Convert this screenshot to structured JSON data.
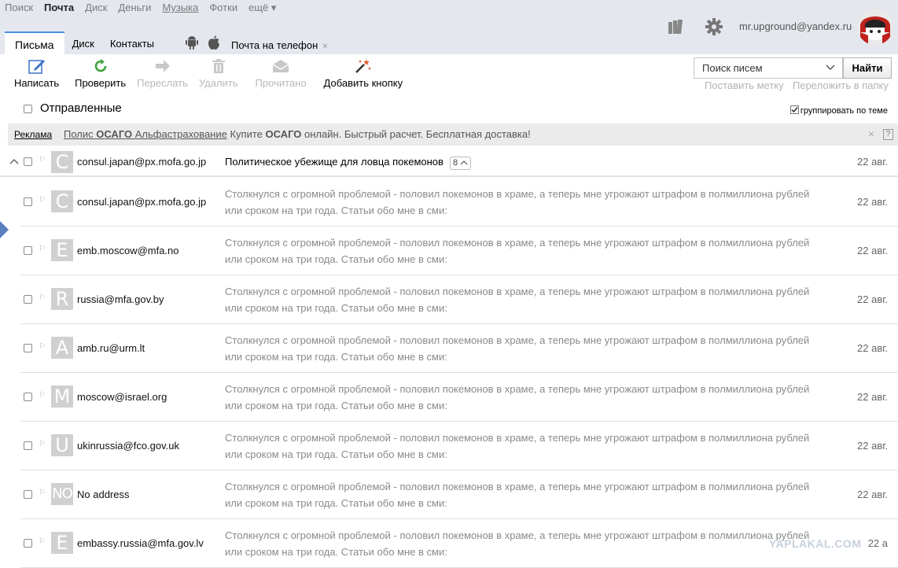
{
  "services": [
    {
      "label": "Поиск",
      "active": false
    },
    {
      "label": "Почта",
      "active": true
    },
    {
      "label": "Диск",
      "active": false
    },
    {
      "label": "Деньги",
      "active": false
    },
    {
      "label": "Музыка",
      "active": false
    },
    {
      "label": "Фотки",
      "active": false
    },
    {
      "label": "ещё ▾",
      "active": false
    }
  ],
  "tabs": [
    {
      "label": "Письма",
      "active": true
    },
    {
      "label": "Диск",
      "active": false
    },
    {
      "label": "Контакты",
      "active": false
    }
  ],
  "phone_link": "Почта на телефон",
  "user": {
    "email": "mr.upground@yandex.ru"
  },
  "toolbar": {
    "compose": "Написать",
    "check": "Проверить",
    "forward": "Переслать",
    "delete": "Удалить",
    "read": "Прочитано",
    "add_button": "Добавить кнопку"
  },
  "search": {
    "placeholder": "Поиск писем",
    "button": "Найти"
  },
  "label_links": {
    "set_label": "Поставить метку",
    "move": "Переложить в папку"
  },
  "folder": {
    "title": "Отправленные",
    "group_label": "группировать по теме"
  },
  "ad": {
    "tag": "Реклама",
    "link_pre": "Полис ",
    "link_bold": "ОСАГО",
    "link_post": " Альфастрахование",
    "text_pre": "Купите ",
    "text_bold": "ОСАГО",
    "text_post": " онлайн. Быстрый расчет. Бесплатная доставка!",
    "close": "×",
    "help": "?"
  },
  "thread": {
    "letter": "C",
    "sender": "consul.japan@px.mofa.go.jp",
    "subject": "Политическое убежище для ловца покемонов",
    "count": "8",
    "date": "22 авг."
  },
  "messages": [
    {
      "letter": "C",
      "sender": "consul.japan@px.mofa.go.jp",
      "line1": "Столкнулся с огромной проблемой - половил покемонов в храме, а теперь мне угрожают штрафом в полмиллиона рублей",
      "line2": "или сроком на три года. Статьи обо мне в сми:",
      "date": "22 авг."
    },
    {
      "letter": "E",
      "sender": "emb.moscow@mfa.no",
      "line1": "Столкнулся с огромной проблемой - половил покемонов в храме, а теперь мне угрожают штрафом в полмиллиона рублей",
      "line2": "или сроком на три года. Статьи обо мне в сми:",
      "date": "22 авг."
    },
    {
      "letter": "R",
      "sender": "russia@mfa.gov.by",
      "line1": "Столкнулся с огромной проблемой - половил покемонов в храме, а теперь мне угрожают штрафом в полмиллиона рублей",
      "line2": "или сроком на три года. Статьи обо мне в сми:",
      "date": "22 авг."
    },
    {
      "letter": "A",
      "sender": "amb.ru@urm.lt",
      "line1": "Столкнулся с огромной проблемой - половил покемонов в храме, а теперь мне угрожают штрафом в полмиллиона рублей",
      "line2": "или сроком на три года. Статьи обо мне в сми:",
      "date": "22 авг."
    },
    {
      "letter": "M",
      "sender": "moscow@israel.org",
      "line1": "Столкнулся с огромной проблемой - половил покемонов в храме, а теперь мне угрожают штрафом в полмиллиона рублей",
      "line2": "или сроком на три года. Статьи обо мне в сми:",
      "date": "22 авг."
    },
    {
      "letter": "U",
      "sender": "ukinrussia@fco.gov.uk",
      "line1": "Столкнулся с огромной проблемой - половил покемонов в храме, а теперь мне угрожают штрафом в полмиллиона рублей",
      "line2": "или сроком на три года. Статьи обо мне в сми:",
      "date": "22 авг."
    },
    {
      "letter": "NO",
      "sender": "No address",
      "line1": "Столкнулся с огромной проблемой - половил покемонов в храме, а теперь мне угрожают штрафом в полмиллиона рублей",
      "line2": "или сроком на три года. Статьи обо мне в сми:",
      "date": "22 авг."
    },
    {
      "letter": "E",
      "sender": "embassy.russia@mfa.gov.lv",
      "line1": "Столкнулся с огромной проблемой - половил покемонов в храме, а теперь мне угрожают штрафом в полмиллиона рублей",
      "line2": "или сроком на три года. Статьи обо мне в сми:",
      "date": "22 а"
    }
  ],
  "watermark": "YAPLAKAL.COM",
  "colors": {
    "header_bg": "#e5e7ee",
    "tab_accent": "#4a90d9",
    "compose_icon": "#3b73c8",
    "check_icon": "#3fa33f",
    "wand_icon": "#e05a2a"
  },
  "icons": {
    "compose": "pencil-icon",
    "check": "refresh-icon",
    "forward": "arrow-right-icon",
    "delete": "trash-icon",
    "read": "envelope-icon",
    "add_button": "magic-wand-icon",
    "settings": "gear-icon",
    "themes": "books-icon",
    "android": "android-icon",
    "apple": "apple-icon"
  }
}
